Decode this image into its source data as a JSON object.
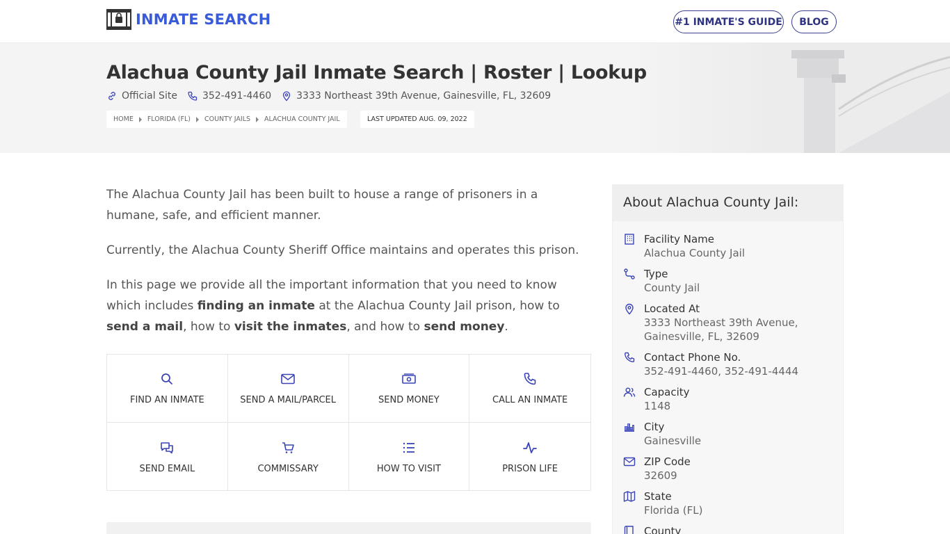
{
  "header": {
    "logo_text": "INMATE SEARCH",
    "nav": [
      {
        "label": "#1 INMATE'S GUIDE"
      },
      {
        "label": "BLOG"
      }
    ]
  },
  "hero": {
    "title": "Alachua County Jail Inmate Search | Roster | Lookup",
    "official_site": "Official Site",
    "phone": "352-491-4460",
    "address": "3333 Northeast 39th Avenue, Gainesville, FL, 32609",
    "breadcrumb": [
      "HOME",
      "FLORIDA (FL)",
      "COUNTY JAILS",
      "ALACHUA COUNTY JAIL"
    ],
    "last_updated": "LAST UPDATED AUG. 09, 2022"
  },
  "intro": {
    "p1": "The Alachua County Jail has been built to house a range of prisoners in a humane, safe, and efficient manner.",
    "p2": "Currently, the Alachua County Sheriff Office maintains and operates this prison.",
    "p3_a": "In this page we provide all the important information that you need to know which includes ",
    "p3_b1": "finding an inmate",
    "p3_c": " at the Alachua County Jail prison, how to ",
    "p3_b2": "send a mail",
    "p3_d": ", how to ",
    "p3_b3": "visit the inmates",
    "p3_e": ", and how to ",
    "p3_b4": "send money",
    "p3_f": "."
  },
  "actions": [
    {
      "label": "FIND AN INMATE",
      "icon": "search-icon"
    },
    {
      "label": "SEND A MAIL/PARCEL",
      "icon": "envelope-icon"
    },
    {
      "label": "SEND MONEY",
      "icon": "money-icon"
    },
    {
      "label": "CALL AN INMATE",
      "icon": "phone-icon"
    },
    {
      "label": "SEND EMAIL",
      "icon": "chat-icon"
    },
    {
      "label": "COMMISSARY",
      "icon": "cart-icon"
    },
    {
      "label": "HOW TO VISIT",
      "icon": "list-icon"
    },
    {
      "label": "PRISON LIFE",
      "icon": "pulse-icon"
    }
  ],
  "sidebar": {
    "title": "About Alachua County Jail:",
    "items": [
      {
        "label": "Facility Name",
        "value": "Alachua County Jail",
        "icon": "building-icon"
      },
      {
        "label": "Type",
        "value": "County Jail",
        "icon": "route-icon"
      },
      {
        "label": "Located At",
        "value": "3333 Northeast 39th Avenue, Gainesville, FL, 32609",
        "icon": "map-pin-icon"
      },
      {
        "label": "Contact Phone No.",
        "value": "352-491-4460, 352-491-4444",
        "icon": "phone-icon"
      },
      {
        "label": "Capacity",
        "value": "1148",
        "icon": "users-icon"
      },
      {
        "label": "City",
        "value": "Gainesville",
        "icon": "city-icon"
      },
      {
        "label": "ZIP Code",
        "value": "32609",
        "icon": "envelope-icon"
      },
      {
        "label": "State",
        "value": "Florida (FL)",
        "icon": "map-icon"
      },
      {
        "label": "County",
        "value": "",
        "icon": "book-icon"
      }
    ]
  },
  "colors": {
    "accent": "#3a5bd9",
    "icon": "#3a43b8",
    "nav_border": "#3a3f8f"
  }
}
